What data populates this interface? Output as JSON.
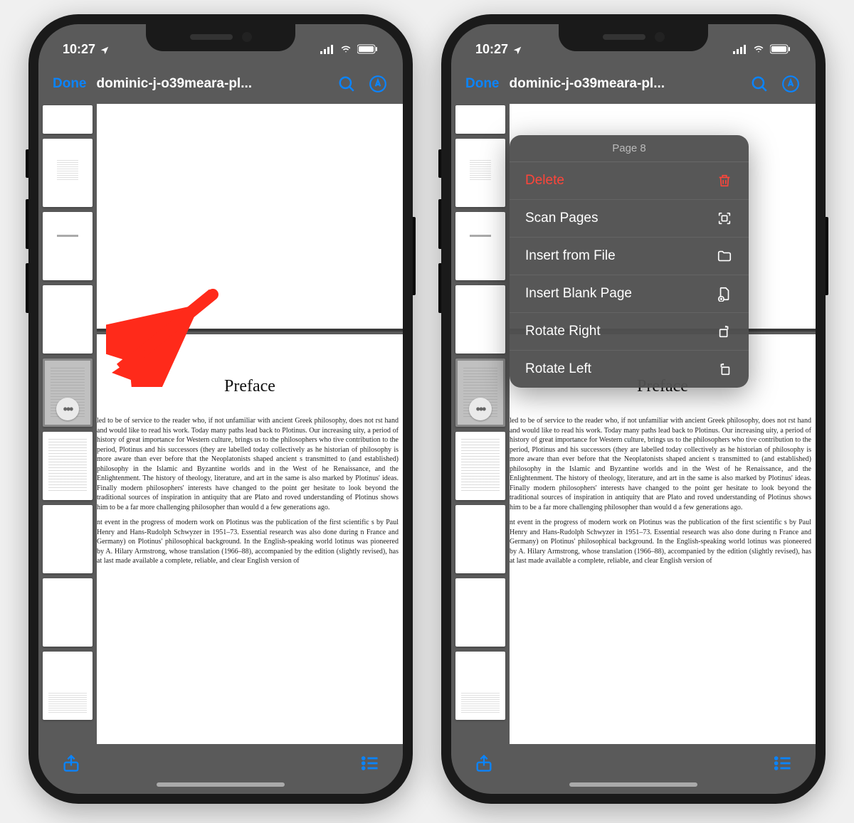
{
  "status": {
    "time": "10:27"
  },
  "nav": {
    "done": "Done",
    "title": "dominic-j-o39meara-pl..."
  },
  "page": {
    "heading": "Preface",
    "para1": "led to be of service to the reader who, if not unfamiliar with ancient Greek philosophy, does not rst hand and would like to read his work. Today many paths lead back to Plotinus. Our increasing uity, a period of history of great importance for Western culture, brings us to the philosophers who tive contribution to the period, Plotinus and his successors (they are labelled today collectively as he historian of philosophy is more aware than ever before that the Neoplatonists shaped ancient s transmitted to (and established) philosophy in the Islamic and Byzantine worlds and in the West of he Renaissance, and the Enlightenment. The history of theology, literature, and art in the same is also marked by Plotinus' ideas. Finally modern philosophers' interests have changed to the point ger hesitate to look beyond the traditional sources of inspiration in antiquity that are Plato and roved understanding of Plotinus shows him to be a far more challenging philosopher than would d a few generations ago.",
    "para2": "nt event in the progress of modern work on Plotinus was the publication of the first scientific s by Paul Henry and Hans-Rudolph Schwyzer in 1951–73. Essential research was also done during n France and Germany) on Plotinus' philosophical background. In the English-speaking world lotinus was pioneered by A. Hilary Armstrong, whose translation (1966–88), accompanied by the edition (slightly revised), has at last made available a complete, reliable, and clear English version of"
  },
  "menu": {
    "header": "Page 8",
    "items": [
      {
        "label": "Delete",
        "destructive": true
      },
      {
        "label": "Scan Pages"
      },
      {
        "label": "Insert from File"
      },
      {
        "label": "Insert Blank Page"
      },
      {
        "label": "Rotate Right"
      },
      {
        "label": "Rotate Left"
      }
    ]
  }
}
